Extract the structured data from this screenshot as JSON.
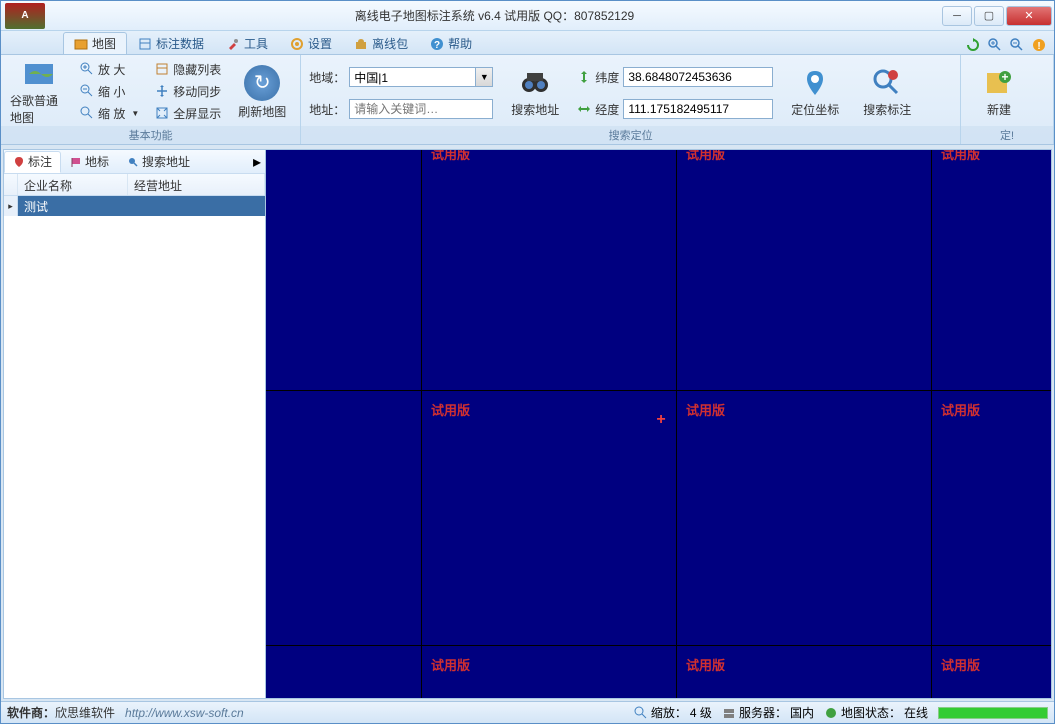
{
  "window": {
    "title": "离线电子地图标注系统 v6.4 试用版 QQ：807852129"
  },
  "tabs": {
    "map": "地图",
    "data": "标注数据",
    "tools": "工具",
    "settings": "设置",
    "offline": "离线包",
    "help": "帮助"
  },
  "ribbon": {
    "group_basic": "基本功能",
    "group_search": "搜索定位",
    "group_mark": "定!",
    "google_map": "谷歌普通地图",
    "zoom_in": "放  大",
    "zoom_out": "缩  小",
    "zoom_fit": "缩  放",
    "hide_list": "隐藏列表",
    "move_sync": "移动同步",
    "fullscreen": "全屏显示",
    "refresh": "刷新地图",
    "region_label": "地域：",
    "region_value": "中国|1",
    "addr_label": "地址：",
    "addr_placeholder": "请输入关键词…",
    "search_addr": "搜索地址",
    "lat_label": "纬度",
    "lat_value": "38.6848072453636",
    "lng_label": "经度",
    "lng_value": "111.175182495117",
    "locate_coord": "定位坐标",
    "search_mark": "搜索标注",
    "new_btn": "新建"
  },
  "left": {
    "tab_mark": "标注",
    "tab_land": "地标",
    "tab_search": "搜索地址",
    "col_name": "企业名称",
    "col_addr": "经营地址",
    "row1_name": "测试"
  },
  "map": {
    "watermark": "试用版"
  },
  "status": {
    "vendor_label": "软件商：",
    "vendor": "欣思维软件",
    "url": "http://www.xsw-soft.cn",
    "zoom_label": "缩放：",
    "zoom_value": "4 级",
    "server_label": "服务器：",
    "server_value": "国内",
    "mapstate_label": "地图状态：",
    "mapstate_value": "在线"
  }
}
